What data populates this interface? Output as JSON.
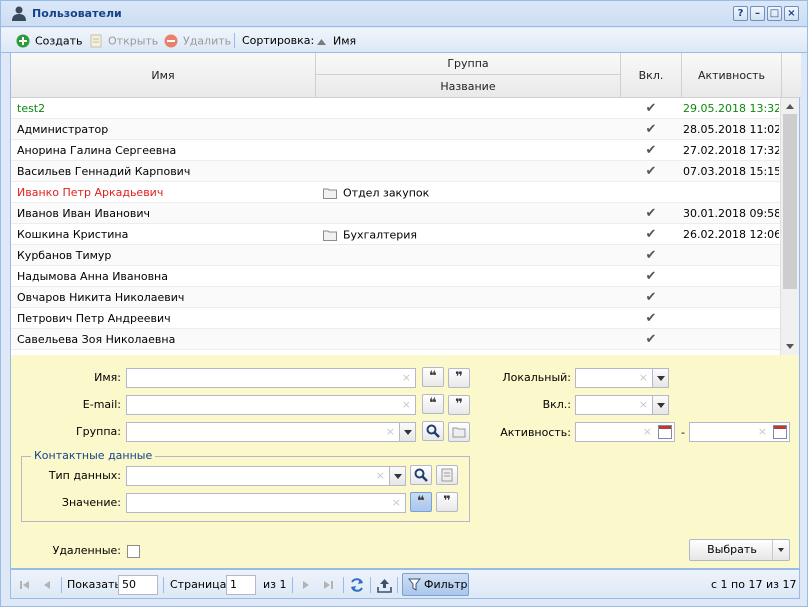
{
  "window": {
    "title": "Пользователи",
    "tools": [
      "?",
      "–",
      "□",
      "×"
    ]
  },
  "toolbar": {
    "create": "Создать",
    "open": "Открыть",
    "delete": "Удалить",
    "sort_label": "Сортировка:",
    "sort_field": "Имя"
  },
  "grid": {
    "headers": {
      "name": "Имя",
      "group": "Группа",
      "group_name": "Название",
      "enabled": "Вкл.",
      "activity": "Активность"
    },
    "rows": [
      {
        "name": "test2",
        "group": "",
        "enabled": "✔",
        "activity": "29.05.2018 13:32",
        "color": "#0b8a0b"
      },
      {
        "name": "Администратор",
        "group": "",
        "enabled": "✔",
        "activity": "28.05.2018 11:02",
        "color": ""
      },
      {
        "name": "Анорина Галина Сергеевна",
        "group": "",
        "enabled": "✔",
        "activity": "27.02.2018 17:32",
        "color": ""
      },
      {
        "name": "Васильев Геннадий Карпович",
        "group": "",
        "enabled": "✔",
        "activity": "07.03.2018 15:15",
        "color": ""
      },
      {
        "name": "Иванко Петр Аркадьевич",
        "group": "Отдел закупок",
        "enabled": "",
        "activity": "",
        "color": "#e02020"
      },
      {
        "name": "Иванов Иван Иванович",
        "group": "",
        "enabled": "✔",
        "activity": "30.01.2018 09:58",
        "color": ""
      },
      {
        "name": "Кошкина Кристина",
        "group": "Бухгалтерия",
        "enabled": "✔",
        "activity": "26.02.2018 12:06",
        "color": ""
      },
      {
        "name": "Курбанов Тимур",
        "group": "",
        "enabled": "✔",
        "activity": "",
        "color": ""
      },
      {
        "name": "Надымова Анна Ивановна",
        "group": "",
        "enabled": "✔",
        "activity": "",
        "color": ""
      },
      {
        "name": "Овчаров Никита Николаевич",
        "group": "",
        "enabled": "✔",
        "activity": "",
        "color": ""
      },
      {
        "name": "Петрович Петр Андреевич",
        "group": "",
        "enabled": "✔",
        "activity": "",
        "color": ""
      },
      {
        "name": "Савельева Зоя Николаевна",
        "group": "",
        "enabled": "✔",
        "activity": "",
        "color": ""
      }
    ]
  },
  "filter": {
    "name_label": "Имя:",
    "email_label": "E-mail:",
    "group_label": "Группа:",
    "contact_legend": "Контактные данные",
    "data_type_label": "Тип данных:",
    "value_label": "Значение:",
    "local_label": "Локальный:",
    "enabled_label": "Вкл.:",
    "activity_label": "Активность:",
    "range_dash": "-",
    "deleted_label": "Удаленные:",
    "select_button": "Выбрать",
    "clear_glyph": "×",
    "quote_open": "❝",
    "quote_close": "❞"
  },
  "paging": {
    "show_label": "Показать",
    "page_size": "50",
    "page_label": "Страница",
    "page_value": "1",
    "of_pages": "из 1",
    "filter_button": "Фильтр",
    "summary": "с 1 по 17 из 17"
  },
  "colors": {
    "title": "#15428b",
    "border": "#99bbe8",
    "filter_bg": "#fbf9cc",
    "create_green": "#2e9b3a",
    "delete_red": "#e8806b"
  }
}
